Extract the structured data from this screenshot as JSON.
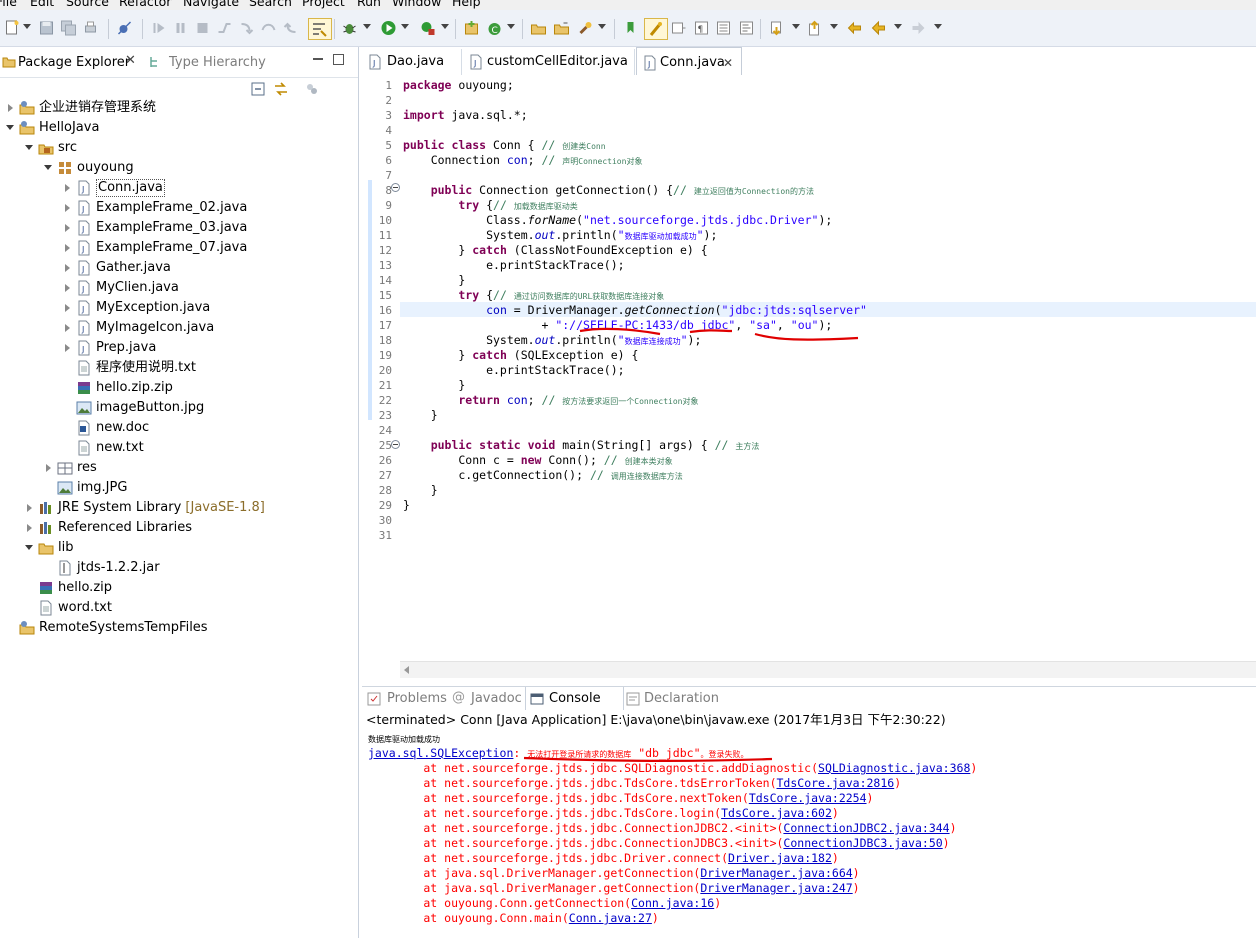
{
  "menu": [
    "File",
    "Edit",
    "Source",
    "Refactor",
    "Navigate",
    "Search",
    "Project",
    "Run",
    "Window",
    "Help"
  ],
  "explorer": {
    "tab_package": "Package Explorer",
    "tab_type": "Type Hierarchy",
    "tree": [
      {
        "label": "企业进销存管理系统",
        "icon": "project-icon",
        "expanded": false
      },
      {
        "label": "HelloJava",
        "icon": "project-icon",
        "expanded": true
      },
      {
        "label": "src",
        "icon": "source-folder-icon",
        "expanded": true
      },
      {
        "label": "ouyoung",
        "icon": "package-icon",
        "expanded": true
      },
      {
        "label": "Conn.java",
        "icon": "java-file-icon",
        "expanded": false,
        "selected": true
      },
      {
        "label": "ExampleFrame_02.java",
        "icon": "java-file-icon",
        "expanded": false
      },
      {
        "label": "ExampleFrame_03.java",
        "icon": "java-file-icon",
        "expanded": false
      },
      {
        "label": "ExampleFrame_07.java",
        "icon": "java-file-icon",
        "expanded": false
      },
      {
        "label": "Gather.java",
        "icon": "java-file-icon",
        "expanded": false
      },
      {
        "label": "MyClien.java",
        "icon": "java-file-icon",
        "expanded": false
      },
      {
        "label": "MyException.java",
        "icon": "java-file-icon",
        "expanded": false
      },
      {
        "label": "MyImageIcon.java",
        "icon": "java-file-icon",
        "expanded": false
      },
      {
        "label": "Prep.java",
        "icon": "java-file-icon",
        "expanded": false
      },
      {
        "label": "程序使用说明.txt",
        "icon": "text-file-icon"
      },
      {
        "label": "hello.zip.zip",
        "icon": "zip-file-icon"
      },
      {
        "label": "imageButton.jpg",
        "icon": "image-file-icon"
      },
      {
        "label": "new.doc",
        "icon": "doc-file-icon"
      },
      {
        "label": "new.txt",
        "icon": "text-file-icon"
      },
      {
        "label": "res",
        "icon": "package-folder-icon",
        "expanded": false
      },
      {
        "label": "img.JPG",
        "icon": "image-file-icon"
      },
      {
        "label": "JRE System Library",
        "decoration": "[JavaSE-1.8]",
        "icon": "library-icon",
        "expanded": false
      },
      {
        "label": "Referenced Libraries",
        "icon": "library-icon",
        "expanded": false
      },
      {
        "label": "lib",
        "icon": "folder-icon",
        "expanded": true
      },
      {
        "label": "jtds-1.2.2.jar",
        "icon": "jar-file-icon"
      },
      {
        "label": "hello.zip",
        "icon": "zip-file-icon"
      },
      {
        "label": "word.txt",
        "icon": "text-file-icon"
      },
      {
        "label": "RemoteSystemsTempFiles",
        "icon": "project-icon",
        "expanded": false
      }
    ]
  },
  "editor_tabs": [
    "Dao.java",
    "customCellEditor.java",
    "Conn.java"
  ],
  "code_line_numbers": [
    "1",
    "2",
    "3",
    "4",
    "5",
    "6",
    "7",
    "8",
    "9",
    "10",
    "11",
    "12",
    "13",
    "14",
    "15",
    "16",
    "17",
    "18",
    "19",
    "20",
    "21",
    "22",
    "23",
    "24",
    "25",
    "26",
    "27",
    "28",
    "29",
    "30",
    "31"
  ],
  "code": {
    "l1a": "package",
    "l1b": " ouyoung;",
    "l3a": "import",
    "l3b": " java.sql.*;",
    "l5a": "public class",
    "l5b": " Conn { ",
    "l5c": "// ",
    "l5d": "创建类Conn",
    "l6a": "    Connection ",
    "l6b": "con",
    "l6c": "; ",
    "l6d": "// ",
    "l6e": "声明Connection对象",
    "l8a": "    public",
    "l8b": " Connection getConnection() {",
    "l8c": "// ",
    "l8d": "建立返回值为Connection的方法",
    "l9a": "        try",
    "l9b": " {",
    "l9c": "// ",
    "l9d": "加载数据库驱动类",
    "l10a": "            Class.",
    "l10b": "forName",
    "l10c": "(",
    "l10d": "\"net.sourceforge.jtds.jdbc.Driver\"",
    "l10e": ");",
    "l11a": "            System.",
    "l11b": "out",
    "l11c": ".println(",
    "l11d": "\"",
    "l11z": "数据库驱动加载成功",
    "l11e": "\"",
    "l11f": ");",
    "l12a": "        } ",
    "l12b": "catch",
    "l12c": " (ClassNotFoundException e) {",
    "l13a": "            e.printStackTrace();",
    "l14a": "        }",
    "l15a": "        try",
    "l15b": " {",
    "l15c": "// ",
    "l15d": "通过访问数据库的URL获取数据库连接对象",
    "l16a": "            ",
    "l16b": "con",
    "l16c": " = DriverManager.",
    "l16d": "getConnection",
    "l16e": "(",
    "l16f": "\"jdbc:jtds:sqlserver\"",
    "l17a": "                    + ",
    "l17b": "\"://SEELE-PC:1433/db_jdbc\"",
    "l17c": ", ",
    "l17d": "\"sa\"",
    "l17e": ", ",
    "l17f": "\"ou\"",
    "l17g": ");",
    "l18a": "            System.",
    "l18b": "out",
    "l18c": ".println(",
    "l18d": "\"",
    "l18z": "数据库连接成功",
    "l18e": "\"",
    "l18f": ");",
    "l19a": "        } ",
    "l19b": "catch",
    "l19c": " (SQLException e) {",
    "l20a": "            e.printStackTrace();",
    "l21a": "        }",
    "l22a": "        return",
    "l22b": " ",
    "l22c": "con",
    "l22d": "; ",
    "l22e": "// ",
    "l22f": "按方法要求返回一个Connection对象",
    "l23a": "    }",
    "l25a": "    public static void",
    "l25b": " main(String[] args) { ",
    "l25c": "// ",
    "l25d": "主方法",
    "l26a": "        Conn c = ",
    "l26b": "new",
    "l26c": " Conn(); ",
    "l26d": "// ",
    "l26e": "创建本类对象",
    "l27a": "        c.getConnection(); ",
    "l27b": "// ",
    "l27c": "调用连接数据库方法",
    "l28a": "    }",
    "l29a": "}"
  },
  "bottom_tabs": [
    "Problems",
    "Javadoc",
    "Console",
    "Declaration"
  ],
  "console": {
    "header": "<terminated> Conn [Java Application] E:\\java\\one\\bin\\javaw.exe (2017年1月3日 下午2:30:22)",
    "line1": "数据库驱动加载成功",
    "exc_link": "java.sql.SQLException",
    "exc_msg_a": ": ",
    "exc_msg_z": "无法打开登录所请求的数据库",
    "exc_msg_b": " \"db_jdbc\"",
    "exc_msg_z2": "。登录失败。",
    "trace": [
      {
        "text": "\tat net.sourceforge.jtds.jdbc.SQLDiagnostic.addDiagnostic(",
        "link": "SQLDiagnostic.java:368",
        "end": ")"
      },
      {
        "text": "\tat net.sourceforge.jtds.jdbc.TdsCore.tdsErrorToken(",
        "link": "TdsCore.java:2816",
        "end": ")"
      },
      {
        "text": "\tat net.sourceforge.jtds.jdbc.TdsCore.nextToken(",
        "link": "TdsCore.java:2254",
        "end": ")"
      },
      {
        "text": "\tat net.sourceforge.jtds.jdbc.TdsCore.login(",
        "link": "TdsCore.java:602",
        "end": ")"
      },
      {
        "text": "\tat net.sourceforge.jtds.jdbc.ConnectionJDBC2.<init>(",
        "link": "ConnectionJDBC2.java:344",
        "end": ")"
      },
      {
        "text": "\tat net.sourceforge.jtds.jdbc.ConnectionJDBC3.<init>(",
        "link": "ConnectionJDBC3.java:50",
        "end": ")"
      },
      {
        "text": "\tat net.sourceforge.jtds.jdbc.Driver.connect(",
        "link": "Driver.java:182",
        "end": ")"
      },
      {
        "text": "\tat java.sql.DriverManager.getConnection(",
        "link": "DriverManager.java:664",
        "end": ")"
      },
      {
        "text": "\tat java.sql.DriverManager.getConnection(",
        "link": "DriverManager.java:247",
        "end": ")"
      },
      {
        "text": "\tat ouyoung.Conn.getConnection(",
        "link": "Conn.java:16",
        "end": ")"
      },
      {
        "text": "\tat ouyoung.Conn.main(",
        "link": "Conn.java:27",
        "end": ")"
      }
    ]
  },
  "colors": {
    "keyword": "#7f0055",
    "string": "#2a00ff",
    "comment": "#3f7f5f",
    "field": "#0000c0",
    "error": "#ff0000",
    "link": "#0000c8",
    "annotation_red": "#e00000"
  }
}
